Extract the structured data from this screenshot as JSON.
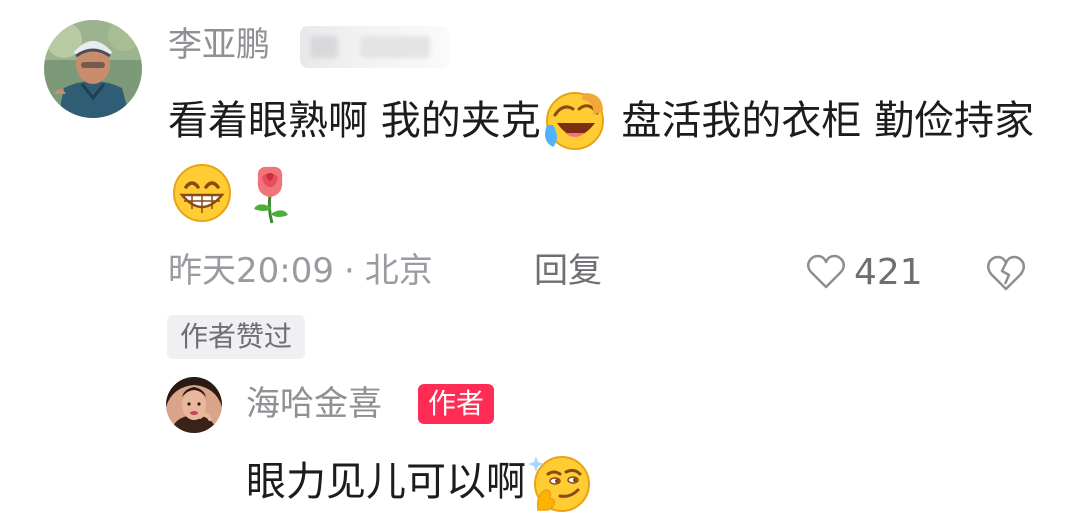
{
  "comment": {
    "username": "李亚鹏",
    "text_part1": "看着眼熟啊 我的夹克",
    "text_part2": " 盘活我的衣柜 勤俭持家",
    "emojis": [
      "laugh-cry-icon",
      "grin-icon",
      "rose-icon"
    ],
    "time": "昨天20:09",
    "separator": "·",
    "location": "北京",
    "reply_label": "回复",
    "like_count": "421",
    "author_liked_label": "作者赞过"
  },
  "reply": {
    "username": "海哈金喜",
    "author_tag": "作者",
    "text": "眼力见儿可以啊",
    "emojis": [
      "smirk-icon"
    ]
  },
  "colors": {
    "text_primary": "#1c1c1e",
    "text_secondary": "#8f8f94",
    "author_tag_bg": "#ff2d55",
    "badge_bg": "#f0f0f2"
  }
}
